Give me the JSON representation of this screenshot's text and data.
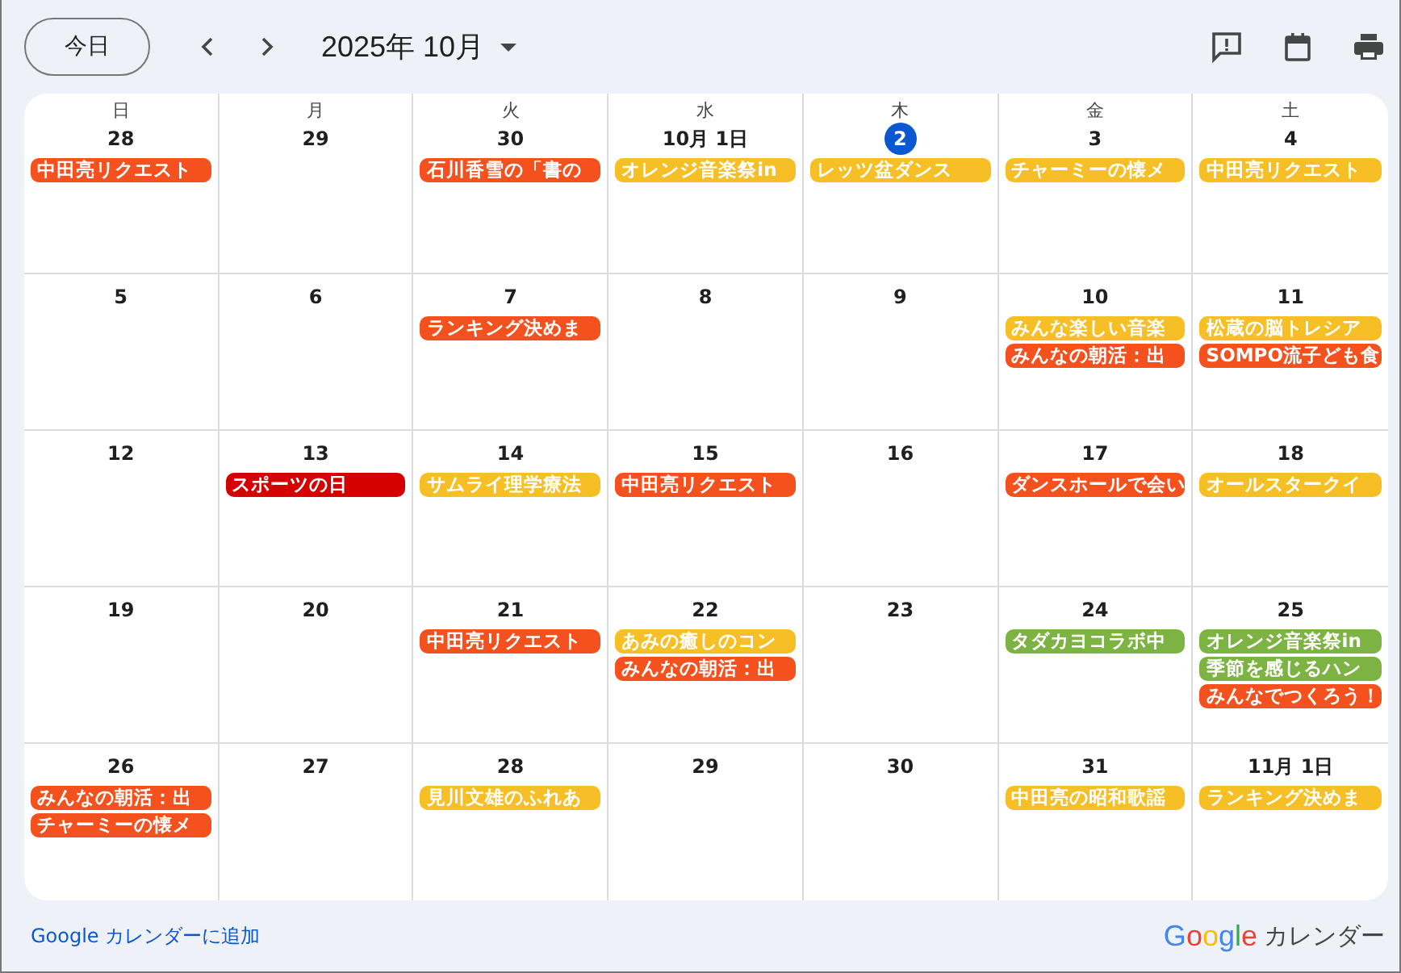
{
  "toolbar": {
    "today_button": "今日",
    "month": "2025年 10月"
  },
  "weekdays": [
    "日",
    "月",
    "火",
    "水",
    "木",
    "金",
    "土"
  ],
  "weeks": [
    {
      "days": [
        {
          "date": "28",
          "today": false,
          "events": [
            {
              "title": "中田亮リクエスト",
              "color": "#f4511e"
            }
          ]
        },
        {
          "date": "29",
          "today": false
        },
        {
          "date": "30",
          "today": false,
          "events": [
            {
              "title": "石川香雪の「書の",
              "color": "#f4511e"
            }
          ]
        },
        {
          "date": "10月 1日",
          "today": false,
          "events": [
            {
              "title": "オレンジ音楽祭in",
              "color": "#f6bf26"
            }
          ]
        },
        {
          "date": "2",
          "today": true,
          "events": [
            {
              "title": "レッツ盆ダンス",
              "color": "#f6bf26"
            }
          ]
        },
        {
          "date": "3",
          "today": false,
          "events": [
            {
              "title": "チャーミーの懐メ",
              "color": "#f6bf26"
            }
          ]
        },
        {
          "date": "4",
          "today": false,
          "events": [
            {
              "title": "中田亮リクエスト",
              "color": "#f6bf26"
            }
          ]
        }
      ]
    },
    {
      "days": [
        {
          "date": "5",
          "today": false
        },
        {
          "date": "6",
          "today": false
        },
        {
          "date": "7",
          "today": false,
          "events": [
            {
              "title": "ランキング決めま",
              "color": "#f4511e"
            }
          ]
        },
        {
          "date": "8",
          "today": false
        },
        {
          "date": "9",
          "today": false
        },
        {
          "date": "10",
          "today": false,
          "events": [
            {
              "title": "みんな楽しい音楽",
              "color": "#f6bf26"
            },
            {
              "title": "みんなの朝活：出",
              "color": "#f4511e"
            }
          ]
        },
        {
          "date": "11",
          "today": false,
          "events": [
            {
              "title": "松蔵の脳トレシア",
              "color": "#f6bf26"
            },
            {
              "title": "SOMPO流子ども食",
              "color": "#f4511e"
            }
          ]
        }
      ]
    },
    {
      "days": [
        {
          "date": "12",
          "today": false
        },
        {
          "date": "13",
          "today": false,
          "events": [
            {
              "title": "スポーツの日",
              "color": "#d50000"
            }
          ]
        },
        {
          "date": "14",
          "today": false,
          "events": [
            {
              "title": "サムライ理学療法",
              "color": "#f6bf26"
            }
          ]
        },
        {
          "date": "15",
          "today": false,
          "events": [
            {
              "title": "中田亮リクエスト",
              "color": "#f4511e"
            }
          ]
        },
        {
          "date": "16",
          "today": false
        },
        {
          "date": "17",
          "today": false,
          "events": [
            {
              "title": "ダンスホールで会い",
              "color": "#f4511e"
            }
          ]
        },
        {
          "date": "18",
          "today": false,
          "events": [
            {
              "title": "オールスタークイ",
              "color": "#f6bf26"
            }
          ]
        }
      ]
    },
    {
      "days": [
        {
          "date": "19",
          "today": false
        },
        {
          "date": "20",
          "today": false
        },
        {
          "date": "21",
          "today": false,
          "events": [
            {
              "title": "中田亮リクエスト",
              "color": "#f4511e"
            }
          ]
        },
        {
          "date": "22",
          "today": false,
          "events": [
            {
              "title": "あみの癒しのコン",
              "color": "#f6bf26"
            },
            {
              "title": "みんなの朝活：出",
              "color": "#f4511e"
            }
          ]
        },
        {
          "date": "23",
          "today": false
        },
        {
          "date": "24",
          "today": false,
          "events": [
            {
              "title": "タダカヨコラボ中",
              "color": "#7cb342"
            }
          ]
        },
        {
          "date": "25",
          "today": false,
          "events": [
            {
              "title": "オレンジ音楽祭in",
              "color": "#7cb342"
            },
            {
              "title": "季節を感じるハン",
              "color": "#7cb342"
            },
            {
              "title": "みんなでつくろう！",
              "color": "#f4511e"
            }
          ]
        }
      ]
    },
    {
      "days": [
        {
          "date": "26",
          "today": false,
          "events": [
            {
              "title": "みんなの朝活：出",
              "color": "#f4511e"
            },
            {
              "title": "チャーミーの懐メ",
              "color": "#f4511e"
            }
          ]
        },
        {
          "date": "27",
          "today": false
        },
        {
          "date": "28",
          "today": false,
          "events": [
            {
              "title": "見川文雄のふれあ",
              "color": "#f6bf26"
            }
          ]
        },
        {
          "date": "29",
          "today": false
        },
        {
          "date": "30",
          "today": false
        },
        {
          "date": "31",
          "today": false,
          "events": [
            {
              "title": "中田亮の昭和歌謡",
              "color": "#f6bf26"
            }
          ]
        },
        {
          "date": "11月 1日",
          "today": false,
          "events": [
            {
              "title": "ランキング決めま",
              "color": "#f6bf26"
            }
          ]
        }
      ]
    }
  ],
  "footer": {
    "link": "Google カレンダーに追加",
    "logo": "Google",
    "product": "カレンダー"
  }
}
